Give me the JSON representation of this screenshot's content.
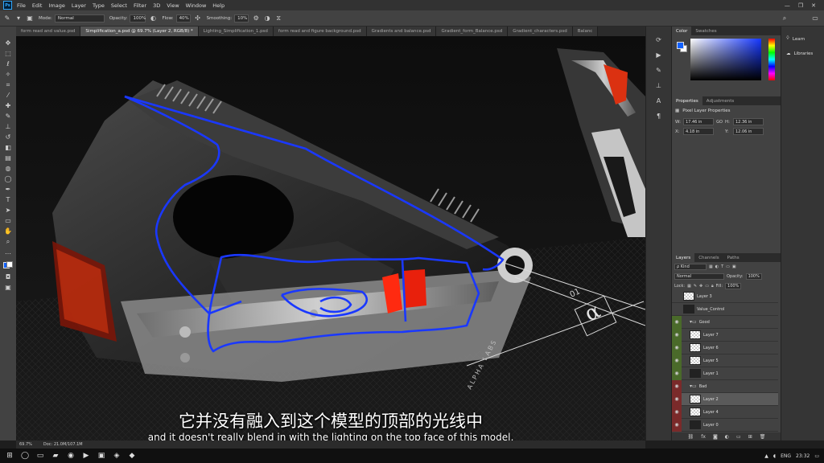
{
  "menu": {
    "logo": "Ps",
    "items": [
      "File",
      "Edit",
      "Image",
      "Layer",
      "Type",
      "Select",
      "Filter",
      "3D",
      "View",
      "Window",
      "Help"
    ],
    "win_min": "—",
    "win_max": "❐",
    "win_close": "✕"
  },
  "options": {
    "mode_label": "Mode:",
    "mode_value": "Normal",
    "opacity_label": "Opacity:",
    "opacity_value": "100%",
    "flow_label": "Flow:",
    "flow_value": "40%",
    "smoothing_label": "Smoothing:",
    "smoothing_value": "10%"
  },
  "tabs": [
    {
      "label": "form read and value.psd",
      "active": false
    },
    {
      "label": "Simplification_a.psd @ 69.7% (Layer 2, RGB/8) *",
      "active": true
    },
    {
      "label": "Lighting_Simplification_1.psd",
      "active": false
    },
    {
      "label": "form read and figure background.psd",
      "active": false
    },
    {
      "label": "Gradients and balance.psd",
      "active": false
    },
    {
      "label": "Gradient_form_Balance.psd",
      "active": false
    },
    {
      "label": "Gradient_characters.psd",
      "active": false
    },
    {
      "label": "Balanc",
      "active": false
    }
  ],
  "status": {
    "zoom": "69.7%",
    "doc": "Doc: 21.0M/107.1M"
  },
  "subtitles": {
    "cn": "它并没有融入到这个模型的顶部的光线中",
    "en": "and it doesn't really blend in with the lighting on the top face of this model,"
  },
  "canvas_art": {
    "brand": "ALPHA LABS",
    "model_number": "01"
  },
  "color_panel": {
    "tab_color": "Color",
    "tab_swatches": "Swatches",
    "foreground": "#1060ff",
    "background": "#ffffff"
  },
  "properties": {
    "tab_properties": "Properties",
    "tab_adjustments": "Adjustments",
    "title": "Pixel Layer Properties",
    "w_label": "W:",
    "w_value": "17.46 in",
    "go_label": "GO",
    "h_label": "H:",
    "h_value": "12.36 in",
    "x_label": "X:",
    "x_value": "4.18 in",
    "y_label": "Y:",
    "y_value": "12.06 in"
  },
  "layers": {
    "tab_layers": "Layers",
    "tab_channels": "Channels",
    "tab_paths": "Paths",
    "kind_label": "ρ Kind",
    "blend_mode": "Normal",
    "opacity_label": "Opacity:",
    "opacity_value": "100%",
    "lock_label": "Lock:",
    "fill_label": "Fill:",
    "fill_value": "100%",
    "rows": [
      {
        "name": "Layer 3",
        "type": "layer",
        "eye": "none",
        "thumb": "checker",
        "selected": false
      },
      {
        "name": "Value_Control",
        "type": "layer",
        "eye": "none",
        "thumb": "dark",
        "selected": false
      },
      {
        "name": "Good",
        "type": "group",
        "eye": "green",
        "selected": false
      },
      {
        "name": "Layer 7",
        "type": "layer",
        "eye": "green",
        "thumb": "checker",
        "selected": false
      },
      {
        "name": "Layer 6",
        "type": "layer",
        "eye": "green",
        "thumb": "checker",
        "selected": false
      },
      {
        "name": "Layer 5",
        "type": "layer",
        "eye": "green",
        "thumb": "checker",
        "selected": false
      },
      {
        "name": "Layer 1",
        "type": "layer",
        "eye": "green",
        "thumb": "dark",
        "selected": false
      },
      {
        "name": "Bad",
        "type": "group",
        "eye": "red",
        "selected": false
      },
      {
        "name": "Layer 2",
        "type": "layer",
        "eye": "red",
        "thumb": "checker",
        "selected": true
      },
      {
        "name": "Layer 4",
        "type": "layer",
        "eye": "red",
        "thumb": "checker",
        "selected": false
      },
      {
        "name": "Layer 0",
        "type": "layer",
        "eye": "red",
        "thumb": "dark",
        "selected": false
      }
    ]
  },
  "learn": {
    "learn_label": "Learn",
    "libraries_label": "Libraries"
  },
  "taskbar": {
    "lang": "ENG",
    "time": "23:32"
  }
}
